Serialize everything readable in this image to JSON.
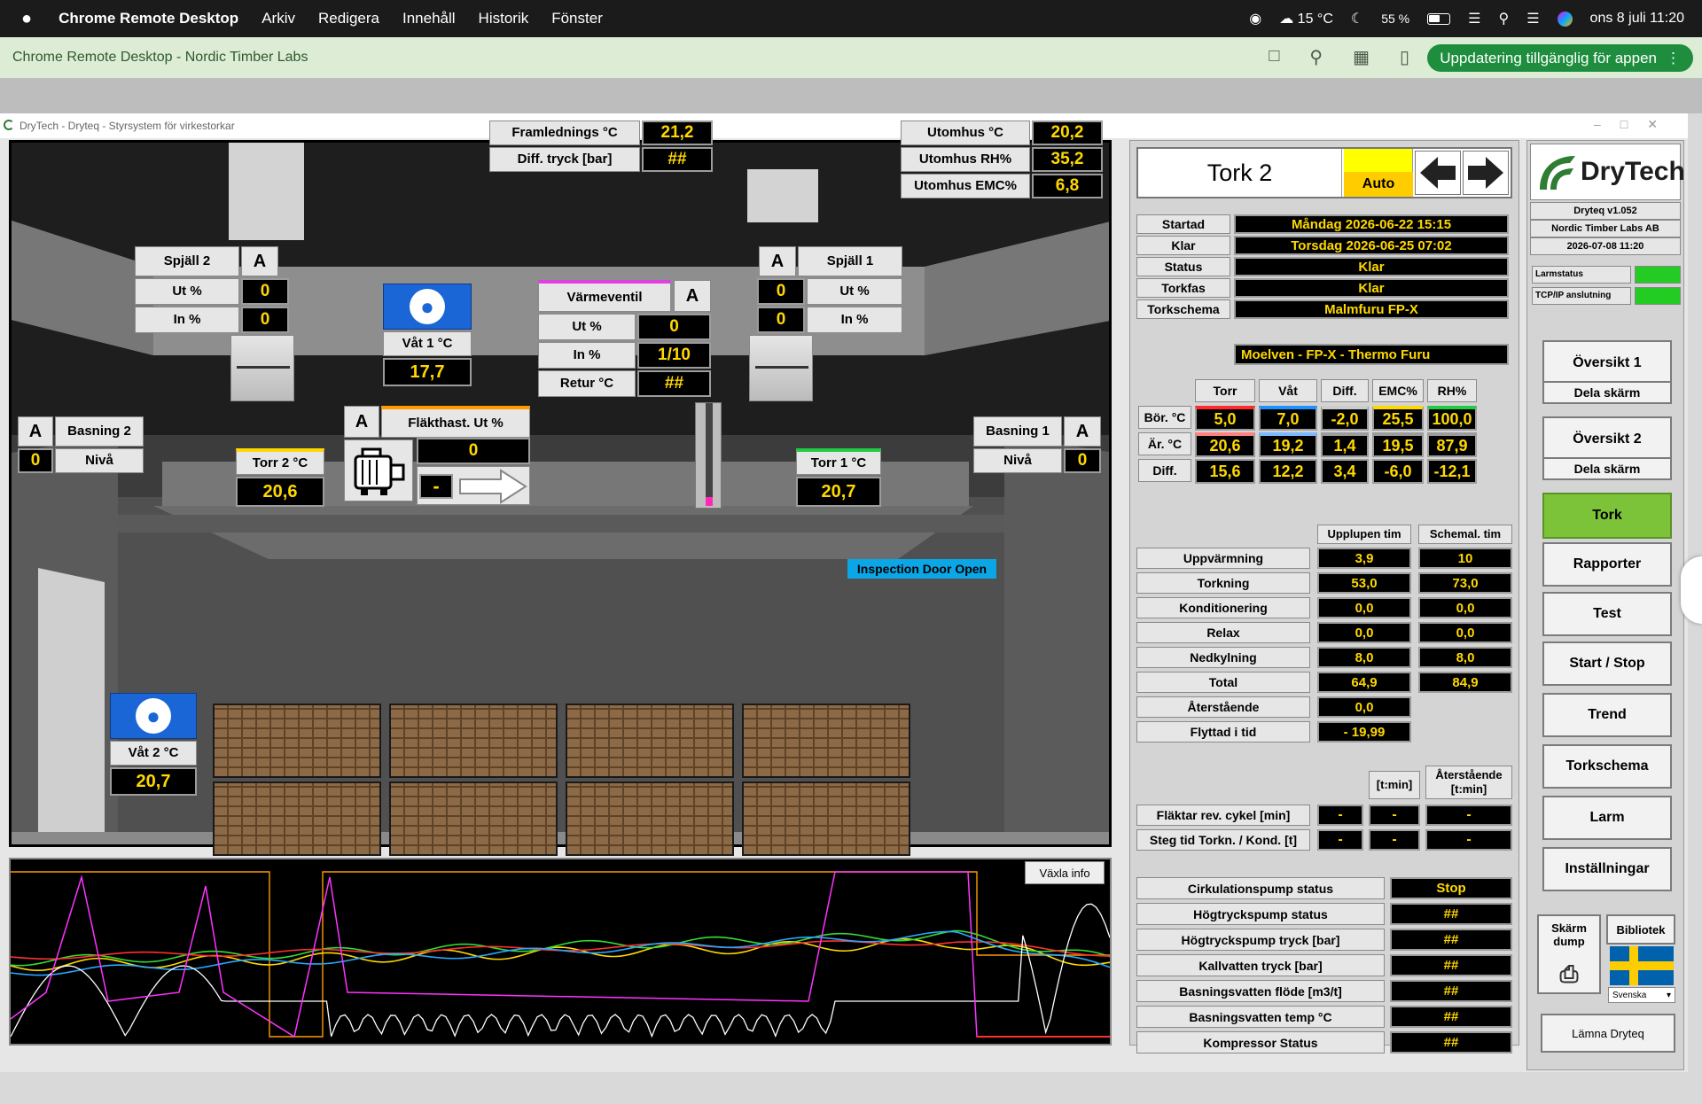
{
  "menubar": {
    "app": "Chrome Remote Desktop",
    "items": [
      "Arkiv",
      "Redigera",
      "Innehåll",
      "Historik",
      "Fönster"
    ],
    "temp": "15 °C",
    "battery": "55 %",
    "datetime": "ons 8 juli 11:20"
  },
  "crd": {
    "title": "Chrome Remote Desktop - Nordic Timber Labs",
    "update": "Uppdatering tillgänglig för appen"
  },
  "window": {
    "title": "DryTech - Dryteq - Styrsystem för virkestorkar"
  },
  "scene": {
    "fram_label": "Framlednings °C",
    "fram_val": "21,2",
    "diff_label": "Diff. tryck [bar]",
    "diff_val": "##",
    "ute_temp_label": "Utomhus °C",
    "ute_temp_val": "20,2",
    "ute_rh_label": "Utomhus RH%",
    "ute_rh_val": "35,2",
    "ute_emc_label": "Utomhus EMC%",
    "ute_emc_val": "6,8",
    "spjall2": {
      "title": "Spjäll 2",
      "mode": "A",
      "ut_label": "Ut %",
      "ut": "0",
      "in_label": "In %",
      "in": "0"
    },
    "spjall1": {
      "title": "Spjäll 1",
      "mode": "A",
      "ut_label": "Ut %",
      "ut": "0",
      "in_label": "In %",
      "in": "0"
    },
    "vat1": {
      "label": "Våt 1 °C",
      "val": "17,7"
    },
    "vat2": {
      "label": "Våt 2 °C",
      "val": "20,7"
    },
    "varme": {
      "title": "Värmeventil",
      "mode": "A",
      "ut_label": "Ut %",
      "ut": "0",
      "in_label": "In %",
      "in": "1/10",
      "retur_label": "Retur °C",
      "retur": "##"
    },
    "basning2": {
      "mode": "A",
      "title": "Basning 2",
      "val": "0",
      "niva": "Nivå"
    },
    "basning1": {
      "mode": "A",
      "title": "Basning 1",
      "val": "0",
      "niva": "Nivå"
    },
    "torr2": {
      "label": "Torr 2 °C",
      "val": "20,6"
    },
    "torr1": {
      "label": "Torr 1 °C",
      "val": "20,7"
    },
    "flakt": {
      "mode": "A",
      "title": "Fläkthast. Ut %",
      "val": "0",
      "dir": "-"
    },
    "inspection": "Inspection Door Open"
  },
  "trend": {
    "toggle": "Växla info"
  },
  "right": {
    "tork_title": "Tork 2",
    "mode": "Auto",
    "info": [
      {
        "label": "Startad",
        "value": "Måndag 2026-06-22 15:15"
      },
      {
        "label": "Klar",
        "value": "Torsdag 2026-06-25 07:02"
      },
      {
        "label": "Status",
        "value": "Klar"
      },
      {
        "label": "Torkfas",
        "value": "Klar"
      },
      {
        "label": "Torkschema",
        "value": "Malmfuru FP-X"
      }
    ],
    "schema_name": "Moelven - FP-X - Thermo Furu",
    "meas": {
      "headers": [
        "Torr",
        "Våt",
        "Diff.",
        "EMC%",
        "RH%"
      ],
      "rows": [
        {
          "label": "Bör. °C",
          "values": [
            "5,0",
            "7,0",
            "-2,0",
            "25,5",
            "100,0"
          ]
        },
        {
          "label": "Är. °C",
          "values": [
            "20,6",
            "19,2",
            "1,4",
            "19,5",
            "87,9"
          ]
        },
        {
          "label": "Diff.",
          "values": [
            "15,6",
            "12,2",
            "3,4",
            "-6,0",
            "-12,1"
          ]
        }
      ]
    },
    "phases": {
      "h1": "Upplupen tim",
      "h2": "Schemal. tim",
      "rows": [
        {
          "label": "Uppvärmning",
          "a": "3,9",
          "b": "10"
        },
        {
          "label": "Torkning",
          "a": "53,0",
          "b": "73,0"
        },
        {
          "label": "Konditionering",
          "a": "0,0",
          "b": "0,0"
        },
        {
          "label": "Relax",
          "a": "0,0",
          "b": "0,0"
        },
        {
          "label": "Nedkylning",
          "a": "8,0",
          "b": "8,0"
        },
        {
          "label": "Total",
          "a": "64,9",
          "b": "84,9"
        },
        {
          "label": "Återstående",
          "a": "0,0"
        },
        {
          "label": "Flyttad i tid",
          "a": "- 19,99"
        }
      ]
    },
    "fan": {
      "h1": "[t:min]",
      "h2": "Återstående [t:min]",
      "rows": [
        {
          "label": "Fläktar rev. cykel [min]",
          "a": "-",
          "b": "-",
          "c": "-"
        },
        {
          "label": "Steg tid Torkn. / Kond. [t]",
          "a": "-",
          "b": "-",
          "c": "-"
        }
      ]
    },
    "pump": [
      {
        "label": "Cirkulationspump status",
        "value": "Stop"
      },
      {
        "label": "Högtryckspump status",
        "value": "##"
      },
      {
        "label": "Högtryckspump tryck [bar]",
        "value": "##"
      },
      {
        "label": "Kallvatten tryck [bar]",
        "value": "##"
      },
      {
        "label": "Basningsvatten flöde [m3/t]",
        "value": "##"
      },
      {
        "label": "Basningsvatten temp °C",
        "value": "##"
      },
      {
        "label": "Kompressor Status",
        "value": "##"
      }
    ]
  },
  "side": {
    "brand": "DryTech",
    "version": "Dryteq v1.052",
    "company": "Nordic Timber Labs AB",
    "date": "2026-07-08 11:20",
    "larm": "Larmstatus",
    "tcp": "TCP/IP anslutning",
    "status_color": "#22cc22",
    "nav": [
      "Översikt 1",
      "Dela skärm",
      "Översikt 2",
      "Dela skärm",
      "Tork",
      "Rapporter",
      "Test",
      "Start / Stop",
      "Trend",
      "Torkschema",
      "Larm",
      "Inställningar"
    ],
    "dump": "Skärm dump",
    "lib": "Bibliotek",
    "lang": "Svenska",
    "exit": "Lämna Dryteq"
  }
}
